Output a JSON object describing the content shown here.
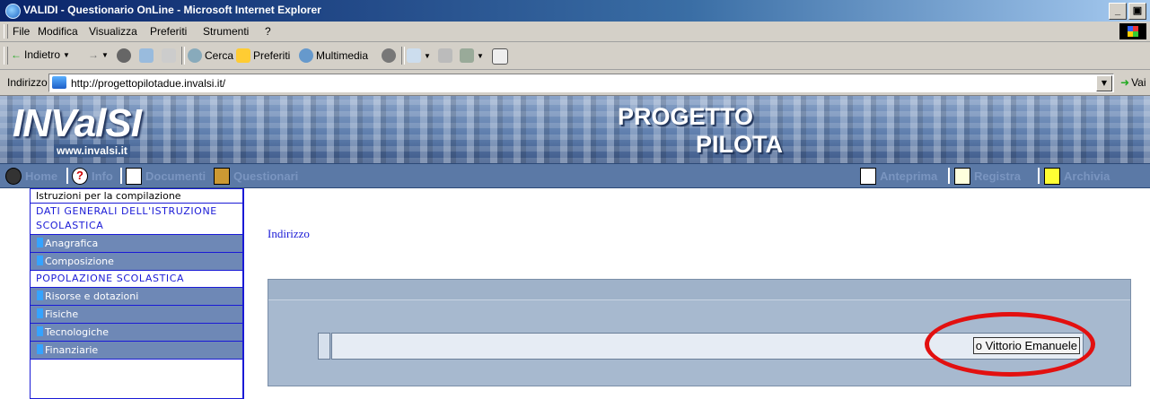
{
  "window": {
    "title": "VALIDI - Questionario OnLine - Microsoft Internet Explorer",
    "controls": [
      "_",
      "ᴑ",
      "X"
    ]
  },
  "menu": [
    "File",
    "Modifica",
    "Visualizza",
    "Preferiti",
    "Strumenti",
    "?"
  ],
  "toolbar": {
    "back": "Indietro",
    "search": "Cerca",
    "favorites": "Preferiti",
    "multimedia": "Multimedia"
  },
  "address": {
    "label": "Indirizzo",
    "url": "http://progettopilotadue.invalsi.it/",
    "go": "Vai"
  },
  "banner": {
    "logo": "INValSI",
    "site": "www.invalsi.it",
    "project_line1": "PROGETTO",
    "project_line2": "PILOTA"
  },
  "nav": {
    "home": "Home",
    "info": "Info",
    "documenti": "Documenti",
    "questionari": "Questionari",
    "anteprima": "Anteprima",
    "registra": "Registra",
    "archivia": "Archivia"
  },
  "sidebar": {
    "items": [
      {
        "label": "Istruzioni per la compilazione",
        "type": "plain"
      },
      {
        "label": "DATI GENERALI DELL'ISTRUZIONE SCOLASTICA",
        "type": "header"
      },
      {
        "label": "Anagrafica",
        "type": "sub"
      },
      {
        "label": "Composizione",
        "type": "sub"
      },
      {
        "label": "POPOLAZIONE SCOLASTICA",
        "type": "header"
      },
      {
        "label": "Risorse e dotazioni",
        "type": "sub"
      },
      {
        "label": "Fisiche",
        "type": "sub"
      },
      {
        "label": "Tecnologiche",
        "type": "sub"
      },
      {
        "label": "Finanziarie",
        "type": "sub"
      }
    ]
  },
  "main": {
    "title": "Indirizzo",
    "field_value": "o Vittorio Emanuele"
  },
  "colors": {
    "highlight": "#e21010",
    "sidebar_border": "#1a1ad6",
    "nav_bg": "#5b79a6"
  }
}
